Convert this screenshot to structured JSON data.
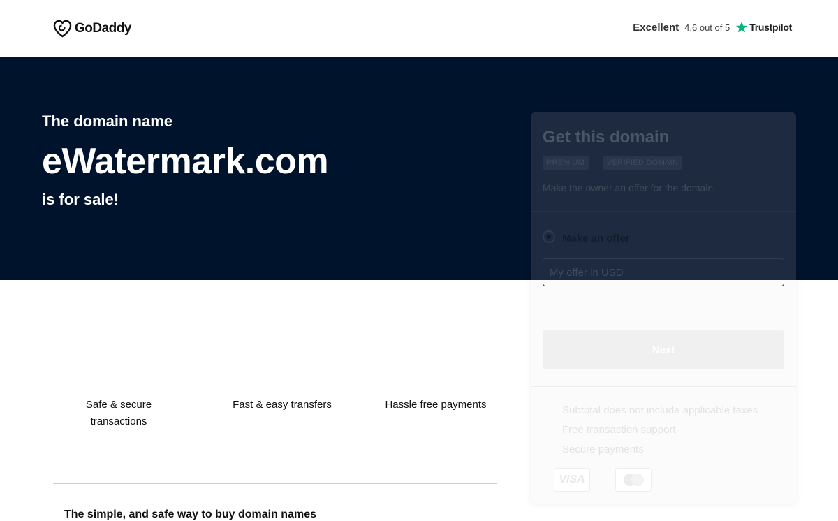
{
  "header": {
    "logo_text": "GoDaddy",
    "rating_label": "Excellent",
    "rating_score": "4.6 out of 5",
    "trustpilot_label": "Trustpilot"
  },
  "hero": {
    "pre_text": "The domain name",
    "domain": "eWatermark.com",
    "post_text": "is for sale!"
  },
  "features": [
    {
      "label": "Safe & secure transactions"
    },
    {
      "label": "Fast & easy transfers"
    },
    {
      "label": "Hassle free payments"
    }
  ],
  "bottom_title": "The simple, and safe way to buy domain names",
  "card": {
    "title": "Get this domain",
    "badges": [
      "PREMIUM",
      "VERIFIED DOMAIN"
    ],
    "subtitle": "Make the owner an offer for the domain.",
    "option_label": "Make an offer",
    "input_placeholder": "My offer in USD",
    "next_label": "Next",
    "info": [
      "Subtotal does not include applicable taxes",
      "Free transaction support",
      "Secure payments"
    ],
    "payment_visa": "VISA"
  },
  "colors": {
    "hero_bg": "#00132c",
    "trustpilot_green": "#00b67a"
  },
  "icons": [
    "godaddy-logo-icon",
    "trustpilot-star-icon",
    "radio-selected-icon",
    "visa-card-icon",
    "mastercard-icon"
  ]
}
